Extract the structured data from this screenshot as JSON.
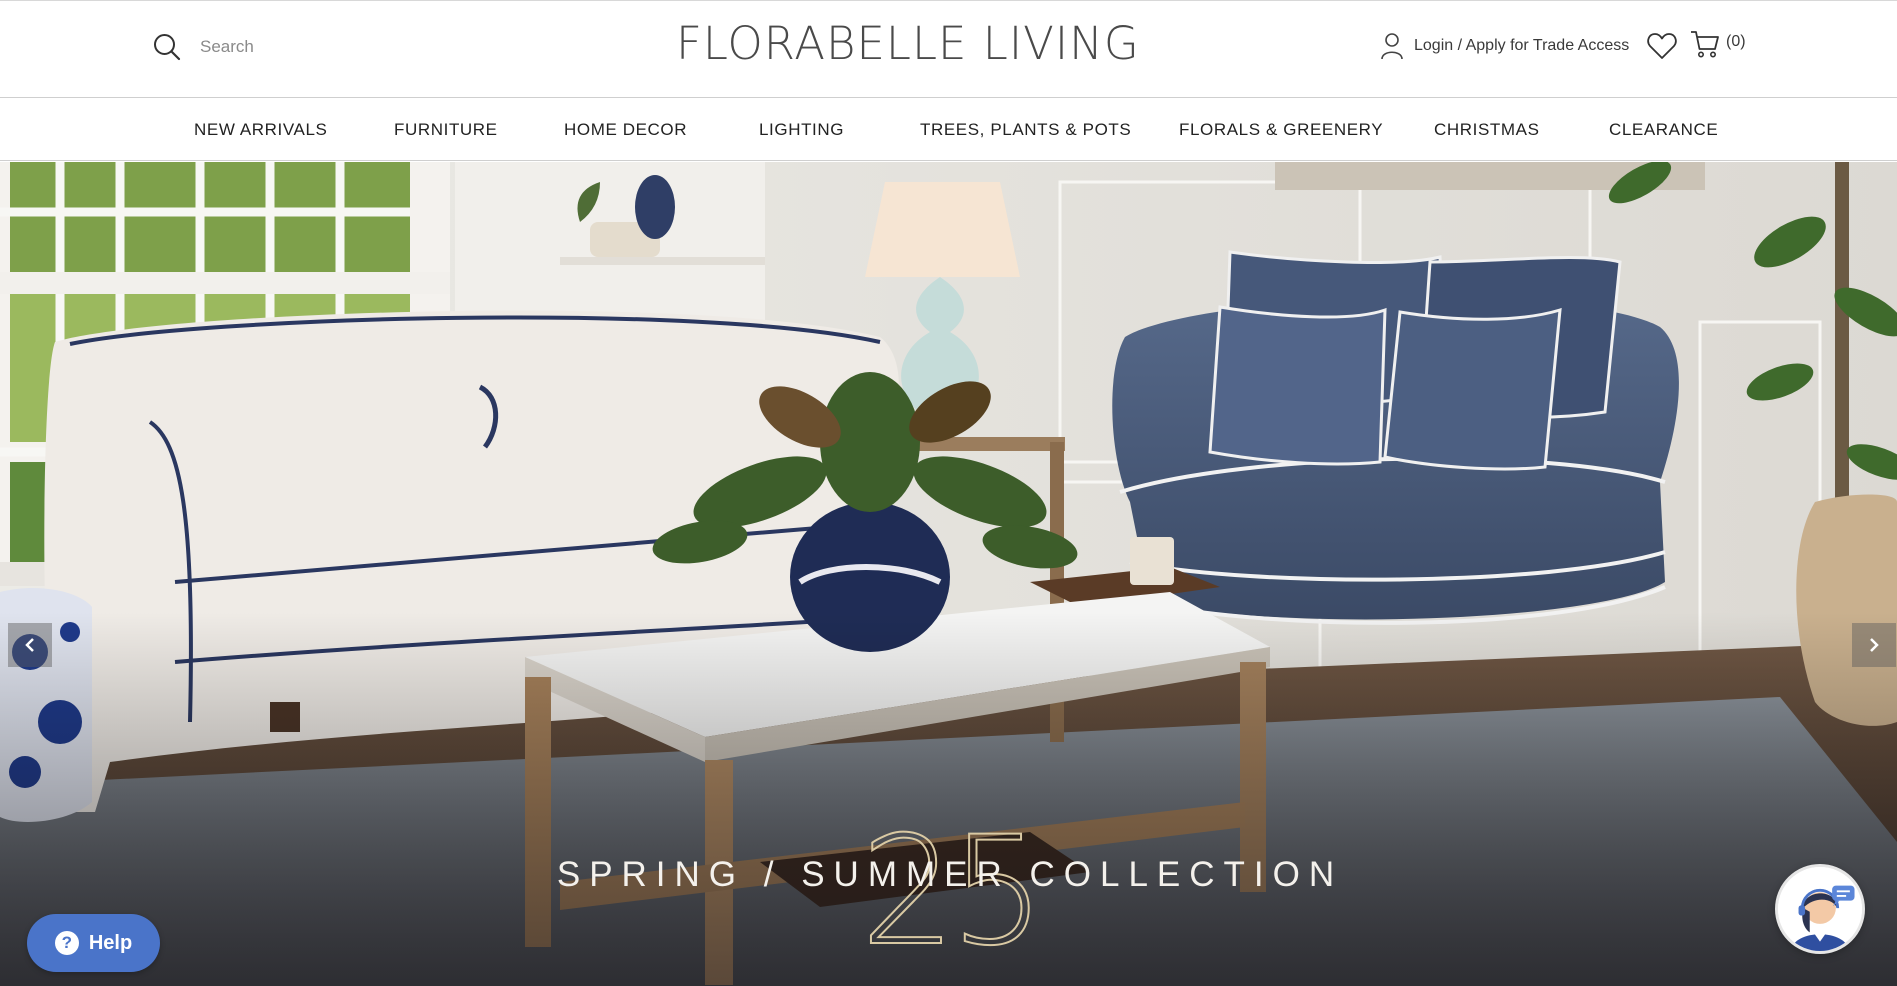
{
  "header": {
    "search": {
      "placeholder": "Search",
      "icon": "search-icon"
    },
    "logo_text": "FLORABELLE LIVING",
    "account": {
      "label": "Login / Apply for Trade Access",
      "icon": "user-icon"
    },
    "wishlist_icon": "heart-icon",
    "cart": {
      "count": "(0)",
      "icon": "cart-icon"
    }
  },
  "nav": {
    "items": [
      {
        "label": "NEW ARRIVALS"
      },
      {
        "label": "FURNITURE"
      },
      {
        "label": "HOME DECOR"
      },
      {
        "label": "LIGHTING"
      },
      {
        "label": "TREES, PLANTS & POTS"
      },
      {
        "label": "FLORALS & GREENERY"
      },
      {
        "label": "CHRISTMAS"
      },
      {
        "label": "CLEARANCE"
      }
    ]
  },
  "hero": {
    "number": "25",
    "collection_text": "SPRING / SUMMER COLLECTION",
    "prev_icon": "chevron-left-icon",
    "next_icon": "chevron-right-icon"
  },
  "help": {
    "label": "Help",
    "icon": "question-icon"
  },
  "chat": {
    "icon": "chat-agent-avatar-icon"
  },
  "colors": {
    "help_button": "#4a74c9",
    "number_outline": "#d9c9a3",
    "sofa_blue": "#4a5a78",
    "sofa_white": "#efebe6"
  }
}
